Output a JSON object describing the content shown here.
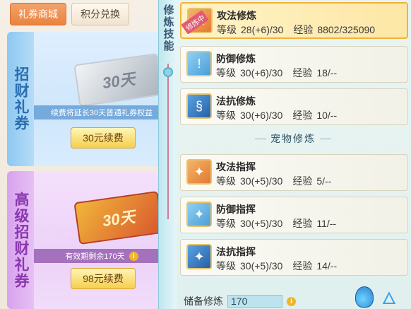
{
  "tabs": {
    "shop": "礼券商城",
    "points": "积分兑换"
  },
  "cards": [
    {
      "title": "招财礼券",
      "ticket_text": "30天",
      "note": "续费将延长30天普通礼券权益",
      "button": "30元续费"
    },
    {
      "title": "高级招财礼券",
      "ticket_text": "30天",
      "note": "有效期剩余170天",
      "button": "98元续费"
    }
  ],
  "divider": {
    "title": "修炼技能"
  },
  "skills": [
    {
      "name": "攻法修炼",
      "level_label": "等级",
      "level": "28(+6)/30",
      "exp_label": "经验",
      "exp": "8802/325090",
      "badge": "修炼中",
      "icon": "sword-icon"
    },
    {
      "name": "防御修炼",
      "level_label": "等级",
      "level": "30(+6)/30",
      "exp_label": "经验",
      "exp": "18/--",
      "icon": "shield-icon"
    },
    {
      "name": "法抗修炼",
      "level_label": "等级",
      "level": "30(+6)/30",
      "exp_label": "经验",
      "exp": "10/--",
      "icon": "magic-shield-icon"
    }
  ],
  "pet_header": "宠物修炼",
  "pet_skills": [
    {
      "name": "攻法指挥",
      "level_label": "等级",
      "level": "30(+5)/30",
      "exp_label": "经验",
      "exp": "5/--",
      "icon": "paw-attack-icon"
    },
    {
      "name": "防御指挥",
      "level_label": "等级",
      "level": "30(+5)/30",
      "exp_label": "经验",
      "exp": "11/--",
      "icon": "paw-shield-icon"
    },
    {
      "name": "法抗指挥",
      "level_label": "等级",
      "level": "30(+5)/30",
      "exp_label": "经验",
      "exp": "14/--",
      "icon": "paw-magic-icon"
    }
  ],
  "reserve": {
    "label": "储备修炼",
    "value": "170"
  },
  "colors": {
    "accent": "#e9833f",
    "button": "#f6cf4c",
    "selected": "#fde7a6"
  }
}
